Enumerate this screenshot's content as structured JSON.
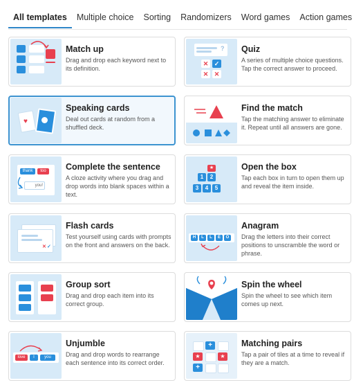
{
  "tabs": [
    "All templates",
    "Multiple choice",
    "Sorting",
    "Randomizers",
    "Word games",
    "Action games"
  ],
  "active_tab": "All templates",
  "templates": [
    {
      "title": "Match up",
      "desc": "Drag and drop each keyword next to its definition.",
      "thumb_icon": "match-up-icon"
    },
    {
      "title": "Quiz",
      "desc": "A series of multiple choice questions. Tap the correct answer to proceed.",
      "thumb_icon": "quiz-icon"
    },
    {
      "title": "Speaking cards",
      "desc": "Deal out cards at random from a shuffled deck.",
      "thumb_icon": "speaking-cards-icon",
      "selected": true
    },
    {
      "title": "Find the match",
      "desc": "Tap the matching answer to eliminate it. Repeat until all answers are gone.",
      "thumb_icon": "find-the-match-icon"
    },
    {
      "title": "Complete the sentence",
      "desc": "A cloze activity where you drag and drop words into blank spaces within a text.",
      "thumb_icon": "complete-sentence-icon",
      "thumb_words": [
        "thank",
        "too",
        "you!"
      ]
    },
    {
      "title": "Open the box",
      "desc": "Tap each box in turn to open them up and reveal the item inside.",
      "thumb_icon": "open-the-box-icon",
      "thumb_numbers": [
        "1",
        "2",
        "3",
        "4",
        "5"
      ]
    },
    {
      "title": "Flash cards",
      "desc": "Test yourself using cards with prompts on the front and answers on the back.",
      "thumb_icon": "flash-cards-icon"
    },
    {
      "title": "Anagram",
      "desc": "Drag the letters into their correct positions to unscramble the word or phrase.",
      "thumb_icon": "anagram-icon",
      "thumb_letters": [
        "H",
        "L",
        "L",
        "E",
        "O"
      ]
    },
    {
      "title": "Group sort",
      "desc": "Drag and drop each item into its correct group.",
      "thumb_icon": "group-sort-icon"
    },
    {
      "title": "Spin the wheel",
      "desc": "Spin the wheel to see which item comes up next.",
      "thumb_icon": "spin-the-wheel-icon"
    },
    {
      "title": "Unjumble",
      "desc": "Drag and drop words to rearrange each sentence into its correct order.",
      "thumb_icon": "unjumble-icon",
      "thumb_words": [
        "love",
        "I",
        "you"
      ]
    },
    {
      "title": "Matching pairs",
      "desc": "Tap a pair of tiles at a time to reveal if they are a match.",
      "thumb_icon": "matching-pairs-icon"
    }
  ],
  "colors": {
    "accent": "#2f86c8",
    "thumb_bg": "#d7eaf8",
    "blue": "#2a8fdc",
    "red": "#e8404f"
  }
}
